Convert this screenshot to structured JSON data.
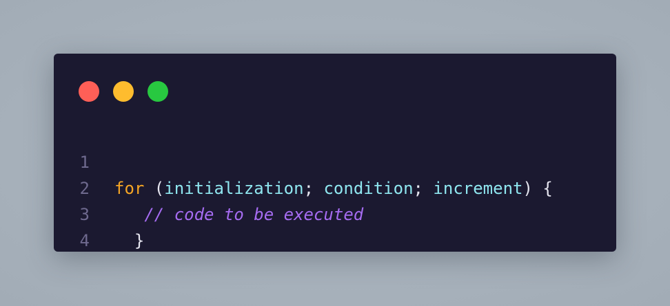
{
  "window": {
    "controls": [
      "close",
      "minimize",
      "maximize"
    ],
    "colors": {
      "close": "#ff5f57",
      "minimize": "#febc2e",
      "maximize": "#28c840",
      "background": "#1b1930"
    }
  },
  "code": {
    "lines": [
      {
        "number": "1",
        "tokens": [
          {
            "text": "for",
            "type": "keyword"
          },
          {
            "text": " (",
            "type": "punct"
          },
          {
            "text": "initialization",
            "type": "ident"
          },
          {
            "text": "; ",
            "type": "punct"
          },
          {
            "text": "condition",
            "type": "ident"
          },
          {
            "text": "; ",
            "type": "punct"
          },
          {
            "text": "increment",
            "type": "ident"
          },
          {
            "text": ") {",
            "type": "punct"
          }
        ]
      },
      {
        "number": "2",
        "tokens": [
          {
            "text": "   // code to be executed",
            "type": "comment"
          }
        ]
      },
      {
        "number": "3",
        "tokens": [
          {
            "text": "  }",
            "type": "punct"
          }
        ]
      },
      {
        "number": "4",
        "tokens": []
      }
    ]
  }
}
